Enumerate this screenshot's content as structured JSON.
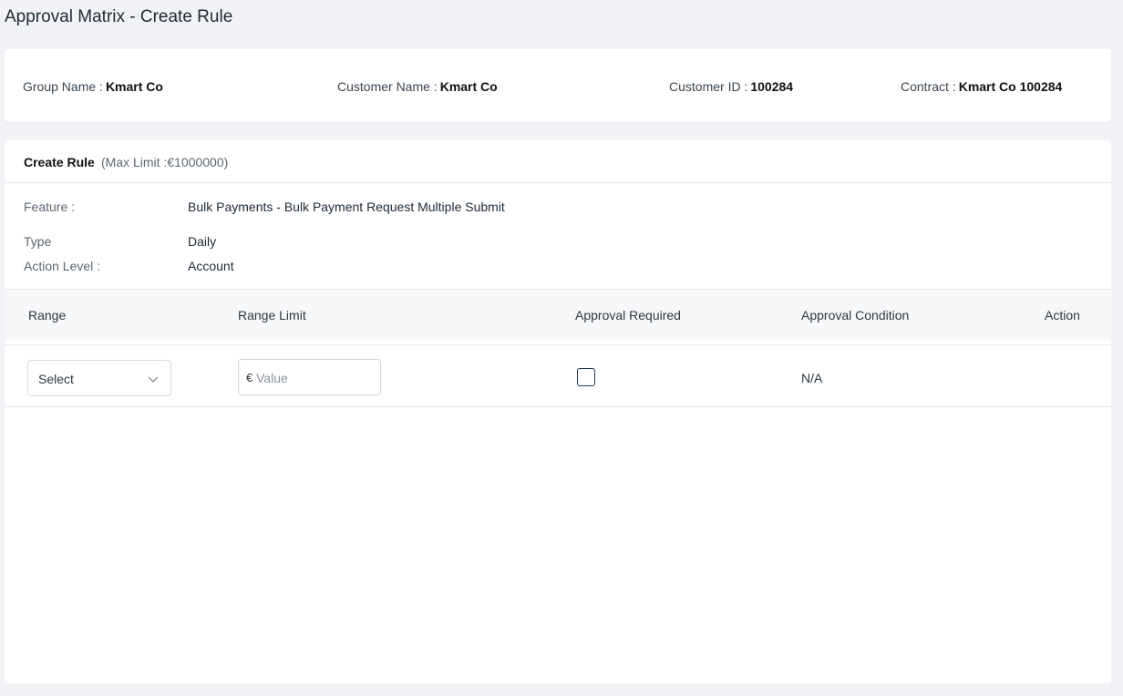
{
  "page": {
    "title": "Approval Matrix - Create Rule"
  },
  "info": {
    "group_name_label": "Group Name :",
    "group_name_value": "Kmart Co",
    "customer_name_label": "Customer Name :",
    "customer_name_value": "Kmart Co",
    "customer_id_label": "Customer ID :",
    "customer_id_value": "100284",
    "contract_label": "Contract :",
    "contract_value": "Kmart Co 100284"
  },
  "rule": {
    "title": "Create Rule",
    "max_limit": "(Max Limit :€1000000)",
    "feature_label": "Feature :",
    "feature_value": "Bulk Payments - Bulk Payment Request Multiple Submit",
    "type_label": "Type",
    "type_value": "Daily",
    "action_level_label": "Action Level :",
    "action_level_value": "Account"
  },
  "table": {
    "columns": [
      "Range",
      "Range Limit",
      "Approval Required",
      "Approval Condition",
      "Action"
    ],
    "row": {
      "range_select": "Select",
      "currency_symbol": "€",
      "value_placeholder": "Value",
      "approval_required_checked": false,
      "approval_condition": "N/A"
    }
  },
  "icons": {
    "select_chevron": "chevron-down-icon"
  },
  "colors": {
    "background": "#f1f3f6",
    "card": "#ffffff",
    "checkbox_border": "#24384f"
  }
}
